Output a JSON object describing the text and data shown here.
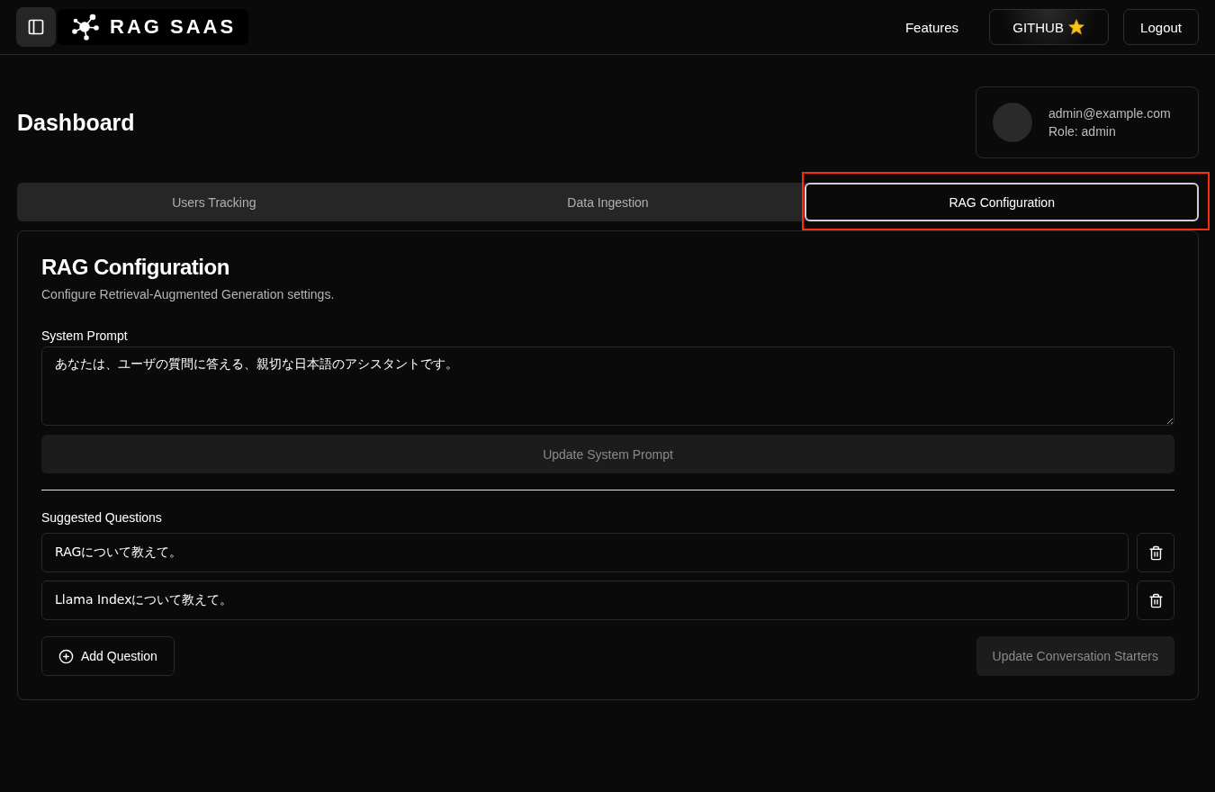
{
  "header": {
    "brand": "RAG SAAS",
    "nav": [
      {
        "label": "Features",
        "kind": "link"
      },
      {
        "label": "GITHUB",
        "kind": "github"
      },
      {
        "label": "Logout",
        "kind": "outline"
      }
    ]
  },
  "page": {
    "title": "Dashboard"
  },
  "user": {
    "email": "admin@example.com",
    "role": "Role: admin"
  },
  "tabs": [
    {
      "label": "Users Tracking",
      "selected": false
    },
    {
      "label": "Data Ingestion",
      "selected": false
    },
    {
      "label": "RAG Configuration",
      "selected": true
    }
  ],
  "config": {
    "title": "RAG Configuration",
    "description": "Configure Retrieval-Augmented Generation settings.",
    "system_prompt": {
      "label": "System Prompt",
      "value": "あなたは、ユーザの質問に答える、親切な日本語のアシスタントです。",
      "button": {
        "label": "Update System Prompt",
        "disabled": true
      }
    },
    "questions_label": "Suggested Questions",
    "questions": [
      {
        "value": "RAGについて教えて。"
      },
      {
        "value": "Llama Indexについて教えて。"
      }
    ],
    "add_button": "Add Question",
    "update_button": {
      "label": "Update Conversation Starters",
      "disabled": true
    }
  }
}
